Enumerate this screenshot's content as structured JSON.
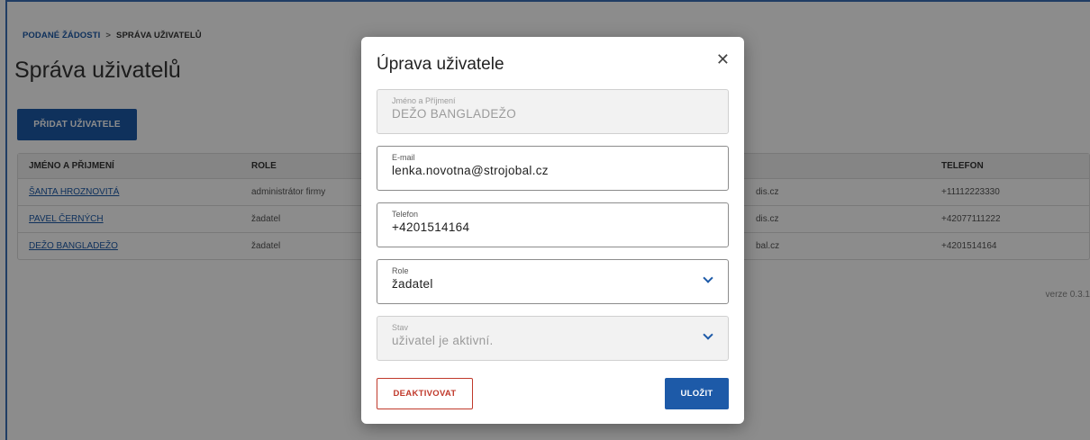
{
  "breadcrumb": {
    "parent": "PODANÉ ŽÁDOSTI",
    "separator": ">",
    "current": "SPRÁVA UŽIVATELŮ"
  },
  "page": {
    "title": "Správa uživatelů",
    "add_button": "PŘIDAT UŽIVATELE",
    "version": "verze 0.3.1"
  },
  "table": {
    "headers": [
      "JMÉNO A PŘIJMENÍ",
      "ROLE",
      "",
      "TELEFON"
    ],
    "rows": [
      {
        "name": "ŠANTA HROZNOVITÁ",
        "role": "administrátor firmy",
        "email": "dis.cz",
        "phone": "+11112223330"
      },
      {
        "name": "PAVEL ČERNÝCH",
        "role": "žadatel",
        "email": "dis.cz",
        "phone": "+42077111222"
      },
      {
        "name": "DEŽO BANGLADEŽO",
        "role": "žadatel",
        "email": "bal.cz",
        "phone": "+4201514164"
      }
    ]
  },
  "modal": {
    "title": "Úprava uživatele",
    "close_icon": "close-icon",
    "fields": {
      "name": {
        "label": "Jméno a Příjmení",
        "value": "DEŽO BANGLADEŽO"
      },
      "email": {
        "label": "E-mail",
        "value": "lenka.novotna@strojobal.cz"
      },
      "phone": {
        "label": "Telefon",
        "value": "+4201514164"
      },
      "role": {
        "label": "Role",
        "value": "žadatel"
      },
      "status": {
        "label": "Stav",
        "value": "uživatel je aktivní."
      }
    },
    "deactivate_button": "DEAKTIVOVAT",
    "save_button": "ULOŽIT"
  },
  "colors": {
    "primary": "#1d5aa8",
    "danger": "#c0392b"
  }
}
